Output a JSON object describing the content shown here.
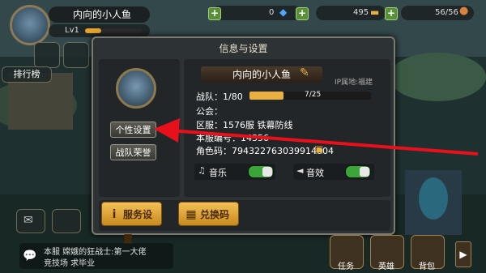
{
  "player": {
    "name": "内向的小人鱼",
    "level": "Lv1",
    "xp_fraction": 0.28
  },
  "resources": {
    "gems": "0",
    "gold": "495",
    "stamina": "56/56"
  },
  "left_panel": {
    "rank_label": "排行榜"
  },
  "dialog": {
    "title": "信息与设置",
    "name": "内向的小人鱼",
    "ip_location": "IP属地:福建",
    "team_label": "战队：1/80",
    "team_progress_text": "7/25",
    "team_progress_fraction": 0.28,
    "guild_label": "公会：",
    "server_label": "区服：1576服 铁幕防线",
    "server_id_label": "本服编号：14356",
    "role_code_label": "角色码：794322763039914004",
    "music_label": "音乐",
    "sfx_label": "音效",
    "music_on": true,
    "sfx_on": true,
    "btn_personal": "个性设置",
    "btn_honor": "战队荣誉",
    "btn_service": "服务设置",
    "btn_redeem": "兑换码"
  },
  "chat": {
    "line1": "本服 嫦娥的狂战士:第一大佬",
    "line2": "竞技场 求毕业"
  },
  "bottom_nav": [
    {
      "label": "任务"
    },
    {
      "label": "英雄"
    },
    {
      "label": "背包"
    }
  ],
  "colors": {
    "accent_yellow": "#e8b040",
    "toggle_green": "#3aa63a",
    "arrow_red": "#e8101a"
  }
}
